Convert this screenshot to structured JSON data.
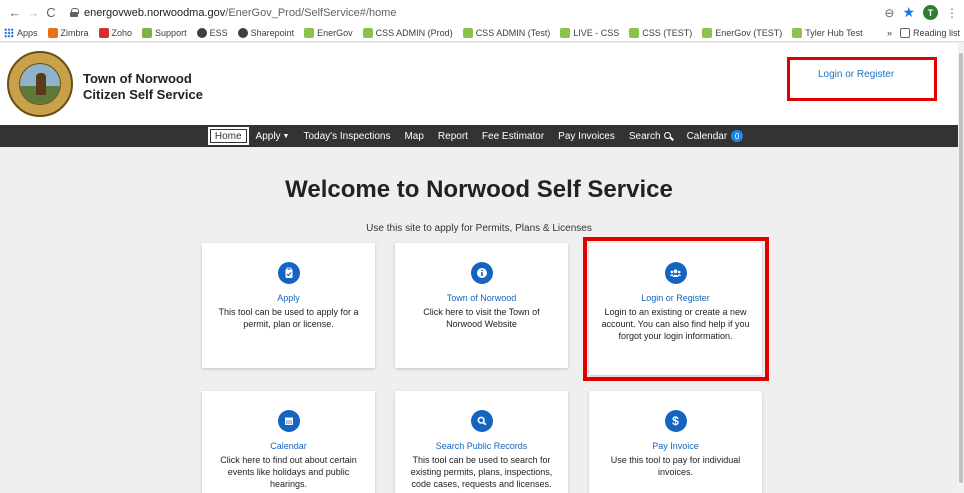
{
  "browser": {
    "url_host": "energovweb.norwoodma.gov",
    "url_path": "/EnerGov_Prod/SelfService#/home",
    "avatar_letter": "T",
    "bookmarks": [
      {
        "label": "Apps",
        "color": "#1a73e8"
      },
      {
        "label": "Zimbra",
        "color": "#e8711a"
      },
      {
        "label": "Zoho",
        "color": "#d32f2f"
      },
      {
        "label": "Support",
        "color": "#7cb342"
      },
      {
        "label": "ESS",
        "color": "#3c4043"
      },
      {
        "label": "Sharepoint",
        "color": "#3c4043"
      },
      {
        "label": "EnerGov",
        "color": "#8bc34a"
      },
      {
        "label": "CSS ADMIN (Prod)",
        "color": "#8bc34a"
      },
      {
        "label": "CSS ADMIN (Test)",
        "color": "#8bc34a"
      },
      {
        "label": "LIVE - CSS",
        "color": "#8bc34a"
      },
      {
        "label": "CSS (TEST)",
        "color": "#8bc34a"
      },
      {
        "label": "EnerGov (TEST)",
        "color": "#8bc34a"
      },
      {
        "label": "Tyler Hub Test",
        "color": "#8bc34a"
      }
    ],
    "overflow": "»",
    "reading_list": "Reading list"
  },
  "header": {
    "title_line1": "Town of Norwood",
    "title_line2": "Citizen Self Service",
    "login_link": "Login or Register"
  },
  "nav": {
    "home": "Home",
    "apply": "Apply",
    "inspections": "Today's Inspections",
    "map": "Map",
    "report": "Report",
    "fee_estimator": "Fee Estimator",
    "pay_invoices": "Pay Invoices",
    "search": "Search",
    "calendar": "Calendar",
    "calendar_count": "0"
  },
  "main": {
    "heading": "Welcome to Norwood Self Service",
    "subtitle": "Use this site to apply for Permits, Plans & Licenses"
  },
  "cards": [
    {
      "title": "Apply",
      "desc": "This tool can be used to apply for a permit, plan or license.",
      "icon": "clipboard-check-icon"
    },
    {
      "title": "Town of Norwood",
      "desc": "Click here to visit the Town of Norwood Website",
      "icon": "info-icon"
    },
    {
      "title": "Login or Register",
      "desc": "Login to an existing or create a new account. You can also find help if you forgot your login information.",
      "icon": "users-icon"
    },
    {
      "title": "Calendar",
      "desc": "Click here to find out about certain events like holidays and public hearings.",
      "icon": "calendar-icon"
    },
    {
      "title": "Search Public Records",
      "desc": "This tool can be used to search for existing permits, plans, inspections, code cases, requests and licenses.",
      "icon": "search-icon"
    },
    {
      "title": "Pay Invoice",
      "desc": "Use this tool to pay for individual invoices.",
      "icon": "dollar-icon"
    }
  ],
  "colors": {
    "highlight": "#e00000",
    "accent": "#1565c0",
    "nav_bg": "#333333"
  }
}
